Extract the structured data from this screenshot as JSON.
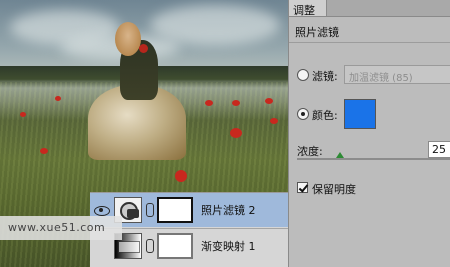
{
  "photo_layers": {
    "adjust_layer_name": "照片滤镜 2",
    "gradient_layer_name": "渐变映射 1"
  },
  "watermark": "www.xue51.com",
  "panel": {
    "tab_label": "调整",
    "title": "照片滤镜",
    "filter_label": "滤镜:",
    "filter_value": "加温滤镜 (85)",
    "color_label": "颜色:",
    "color_value": "#1a73e8",
    "density_label": "浓度:",
    "density_value": "25",
    "preserve_label": "保留明度"
  }
}
